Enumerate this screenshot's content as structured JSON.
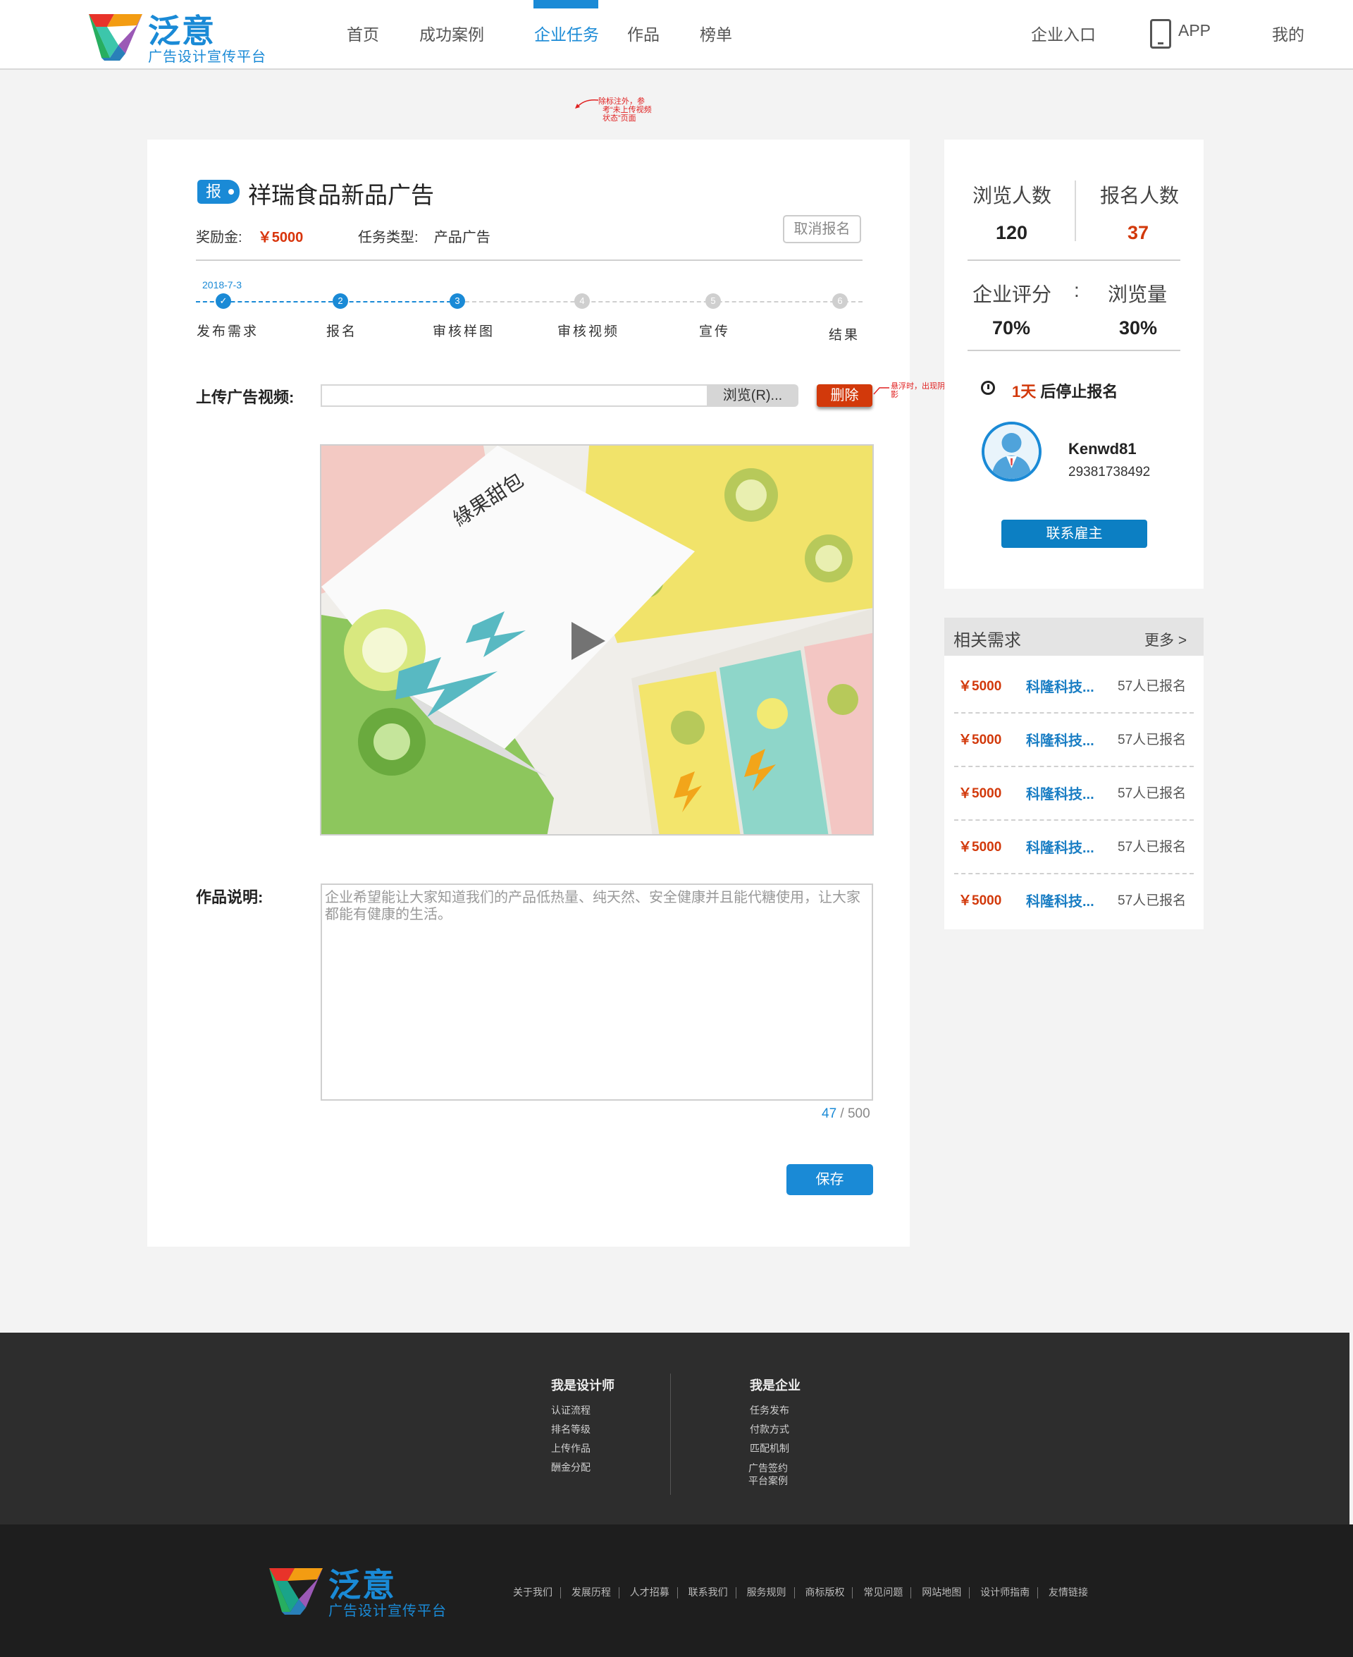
{
  "header": {
    "logo_name": "泛意",
    "logo_sub": "广告设计宣传平台",
    "nav": [
      "首页",
      "成功案例",
      "企业任务",
      "作品",
      "榜单"
    ],
    "active_nav": "企业任务",
    "right": {
      "enterprise": "企业入口",
      "app": "APP",
      "mine": "我的"
    }
  },
  "annotations": {
    "top": [
      "除标注外，参",
      "考“未上传视频",
      "状态”页面"
    ],
    "delete": [
      "悬浮时，出现阴",
      "影"
    ]
  },
  "task": {
    "badge": "报",
    "title": "祥瑞食品新品广告",
    "reward_label": "奖励金:",
    "reward_value": "￥5000",
    "type_label": "任务类型:",
    "type_value": "产品广告",
    "cancel_label": "取消报名"
  },
  "steps": {
    "date": "2018-7-3",
    "items": [
      {
        "num": "✓",
        "label": "发布需求",
        "state": "done"
      },
      {
        "num": "2",
        "label": "报名",
        "state": "done"
      },
      {
        "num": "3",
        "label": "审核样图",
        "state": "done"
      },
      {
        "num": "4",
        "label": "审核视频",
        "state": "todo"
      },
      {
        "num": "5",
        "label": "宣传",
        "state": "todo"
      },
      {
        "num": "6",
        "label": "结果",
        "state": "todo"
      }
    ]
  },
  "upload": {
    "label": "上传广告视频:",
    "value": "",
    "browse_label": "浏览(R)...",
    "delete_label": "删除"
  },
  "description": {
    "label": "作品说明:",
    "text": "企业希望能让大家知道我们的产品低热量、纯天然、安全健康并且能代糖使用，让大家都能有健康的生活。",
    "count": "47",
    "max": "/ 500",
    "save_label": "保存"
  },
  "stats": {
    "views_label": "浏览人数",
    "views": "120",
    "signups_label": "报名人数",
    "signups": "37",
    "rating_label": "企业评分",
    "colon": ":",
    "volume_label": "浏览量",
    "rating": "70%",
    "volume": "30%",
    "deadline_days": "1天",
    "deadline_suffix": " 后停止报名",
    "user_name": "Kenwd81",
    "user_id": "29381738492",
    "contact_label": "联系雇主"
  },
  "related": {
    "title": "相关需求",
    "more": "更多 >",
    "items": [
      {
        "price": "￥5000",
        "name": "科隆科技...",
        "count": "57人已报名"
      },
      {
        "price": "￥5000",
        "name": "科隆科技...",
        "count": "57人已报名"
      },
      {
        "price": "￥5000",
        "name": "科隆科技...",
        "count": "57人已报名"
      },
      {
        "price": "￥5000",
        "name": "科隆科技...",
        "count": "57人已报名"
      },
      {
        "price": "￥5000",
        "name": "科隆科技...",
        "count": "57人已报名"
      }
    ]
  },
  "footer": {
    "designer_title": "我是设计师",
    "designer_links": [
      "认证流程",
      "排名等级",
      "上传作品",
      "酬金分配"
    ],
    "company_title": "我是企业",
    "company_links": [
      "任务发布",
      "付款方式",
      "匹配机制"
    ],
    "company_extra": [
      "广告签约",
      "平台案例"
    ],
    "bottom_links": [
      "关于我们",
      "发展历程",
      "人才招募",
      "联系我们",
      "服务规则",
      "商标版权",
      "常见问题",
      "网站地图",
      "设计师指南",
      "友情链接"
    ]
  },
  "colors": {
    "accent": "#1a8ad6",
    "danger": "#d2390b",
    "footer": "#2d2d2d"
  }
}
